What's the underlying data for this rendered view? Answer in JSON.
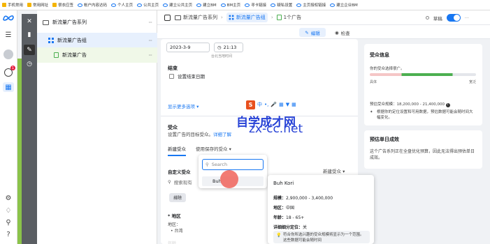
{
  "bookmarks": [
    "手机常用",
    "常用网址",
    "很衣应签",
    "帐户内容达码",
    "个人主页",
    "公共主页",
    "建立公共主页",
    "建立BM",
    "BM主页",
    "寻卡链接",
    "疑私设置",
    "主页授权链接",
    "建立企业BM"
  ],
  "rail": {
    "badge": "1"
  },
  "tree": {
    "campaign": "新流量广告系列",
    "adset": "新流量广告组",
    "ad": "新流量广告",
    "more": "···"
  },
  "header": {
    "crumb_campaign": "新流量广告系列",
    "crumb_adset": "新流量广告组",
    "crumb_ad": "1个广告",
    "draft": "草稿",
    "more": "···",
    "edit_label": "编辑",
    "review_label": "检查"
  },
  "schedule": {
    "date": "2023-3-9",
    "time": "21:13",
    "timezone": "台北当地时间",
    "end_label": "结束",
    "end_checkbox_label": "设置结束日期",
    "more_options": "显示更多选项 ▾"
  },
  "audience": {
    "title": "受众",
    "description": "设置广告的目标受众。",
    "learn_more": "详细了解",
    "tab_new": "新建受众",
    "tab_saved": "使用保存的受众 ▾",
    "custom_label": "自定义受众",
    "new_audience_btn": "新建受众 ▾",
    "search_placeholder": "搜索现有",
    "exclude": "排除",
    "region_title": "* 地区",
    "region_sub": "地区：",
    "region_item": "• 台湾",
    "cut_label": "年龄"
  },
  "dropdown": {
    "search_placeholder": "Search",
    "item": "Buh"
  },
  "tooltip": {
    "name": "Buh Kori",
    "size_label": "规模：",
    "size_value": "2,900,000 - 3,400,000",
    "region_label": "地区：",
    "region_value": "中国",
    "age_label": "年龄：",
    "age_value": "18 - 65+",
    "detail_label": "详细细分定位：",
    "detail_value": "关",
    "note": "符合你所选兴趣的受众规模将显示为一个范围。这些数据可能会随时间"
  },
  "audience_panel": {
    "title": "受众信息",
    "subtitle": "你的受众选择很广。",
    "gauge_left": "具体",
    "gauge_right": "宽泛",
    "gauge_fill_start": 0.3,
    "gauge_fill_end": 0.78,
    "estimate": "预估受众规模：18,200,000 - 21,400,000",
    "estimate_note": "根据你的定位设置和可用数据，预估数据可能会随时间大幅变化。"
  },
  "single_day_panel": {
    "title": "预估单日成效",
    "text": "这个广告系列正在全盘优化预算，因此无法得出预估单日成效。"
  },
  "watermark": {
    "big_text": "自学成才网",
    "url": "zx-cc.net"
  }
}
